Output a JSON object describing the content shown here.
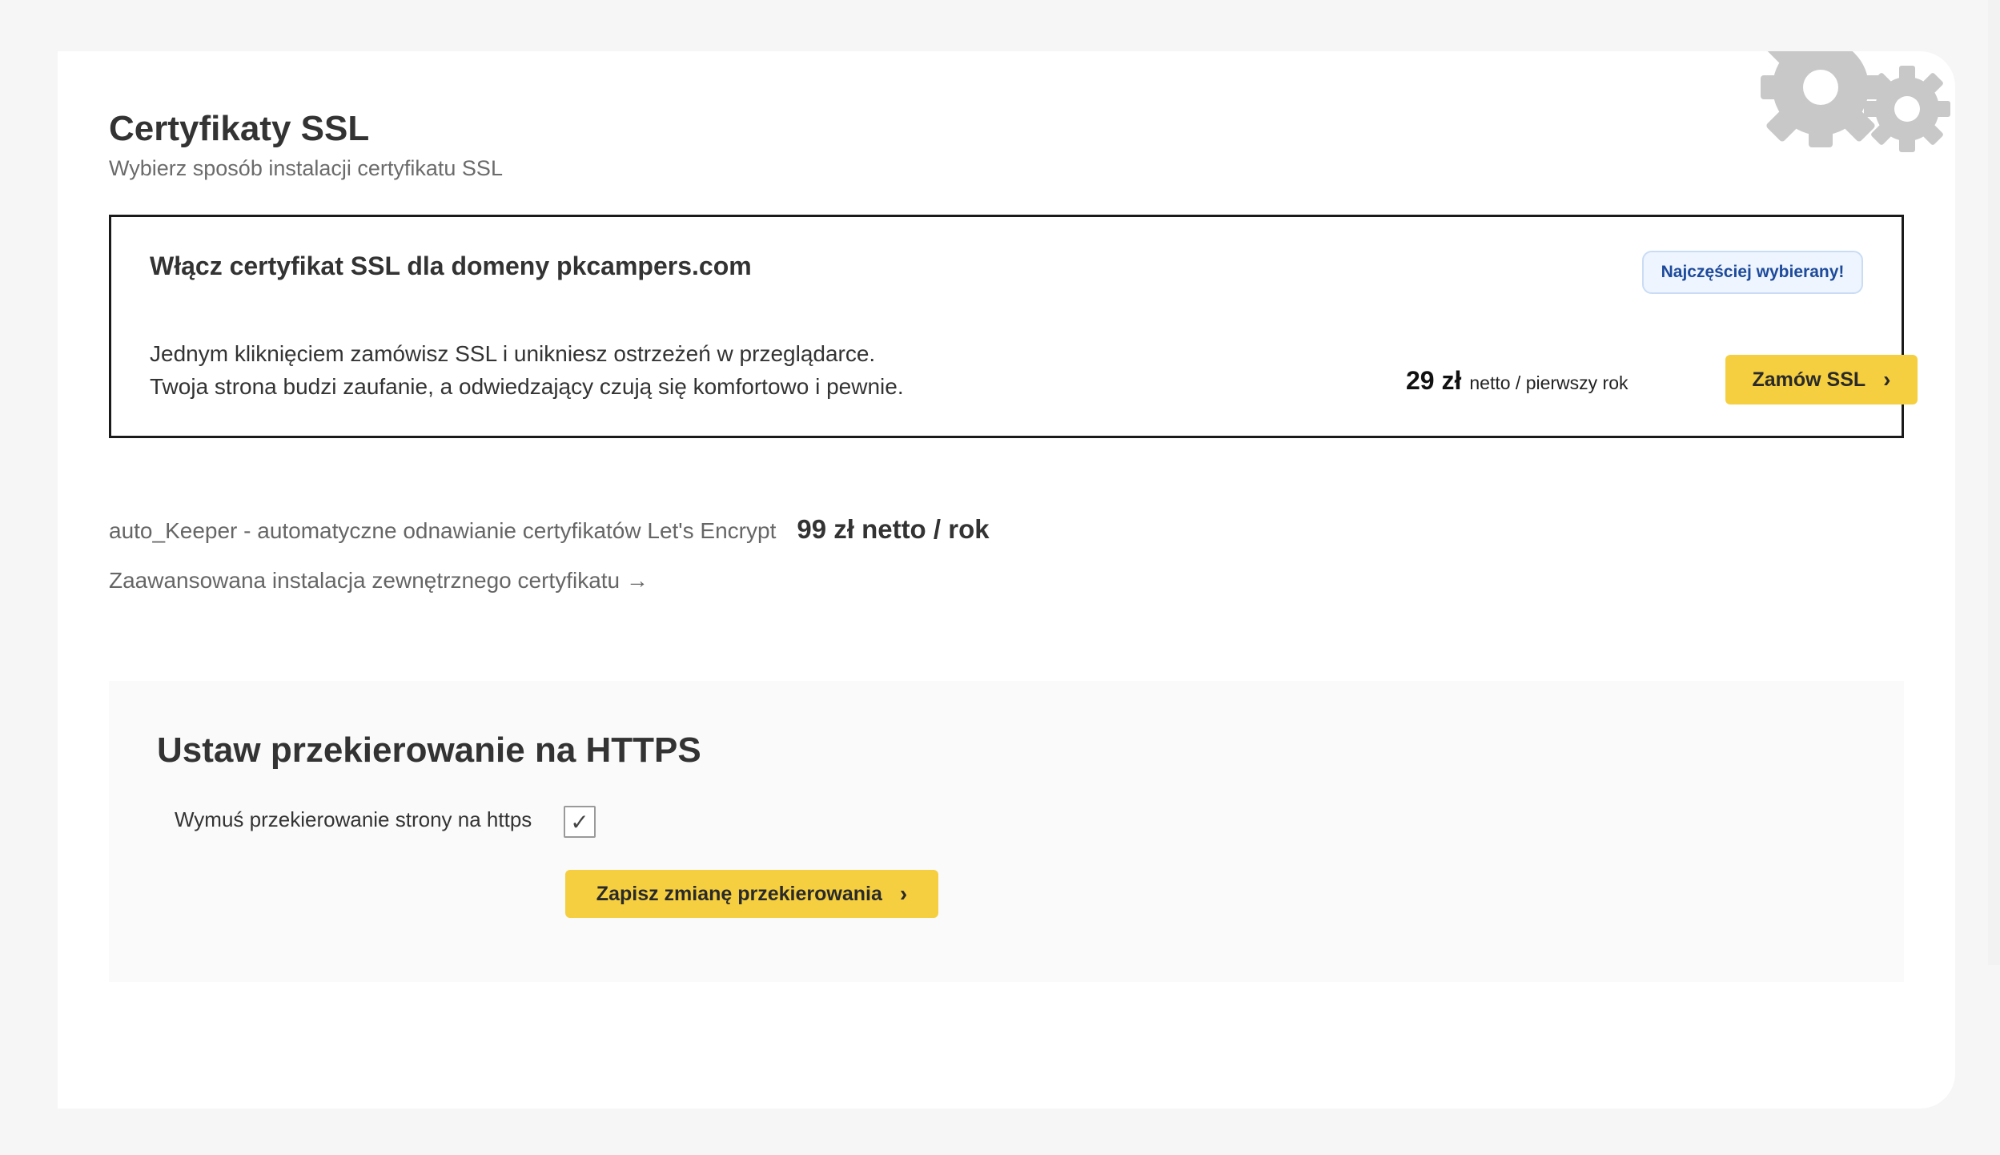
{
  "header": {
    "title": "Certyfikaty SSL",
    "subtitle": "Wybierz sposób instalacji certyfikatu SSL"
  },
  "offer": {
    "title": "Włącz certyfikat SSL dla domeny pkcampers.com",
    "badge": "Najczęściej wybierany!",
    "description_line1": "Jednym kliknięciem zamówisz SSL i unikniesz ostrzeżeń w przeglądarce.",
    "description_line2": "Twoja strona budzi zaufanie, a odwiedzający czują się komfortowo i pewnie.",
    "price_amount": "29 zł",
    "price_unit": "netto / pierwszy rok",
    "button_label": "Zamów SSL",
    "button_icon": "chevron-right-icon"
  },
  "autokeeper": {
    "label": "auto_Keeper - automatyczne odnawianie certyfikatów Let's Encrypt",
    "price": "99 zł netto / rok"
  },
  "advanced": {
    "link_label": "Zaawansowana instalacja zewnętrznego certyfikatu →"
  },
  "https": {
    "title": "Ustaw przekierowanie na HTTPS",
    "checkbox_label": "Wymuś przekierowanie strony na https",
    "checkbox_checked": true,
    "checkbox_mark": "✓",
    "save_button_label": "Zapisz zmianę przekierowania"
  },
  "colors": {
    "accent_button": "#f5cf3f",
    "badge_text": "#1d4a9a",
    "badge_background": "#eef5ff",
    "decorative_gears": "#c8c8c8"
  }
}
